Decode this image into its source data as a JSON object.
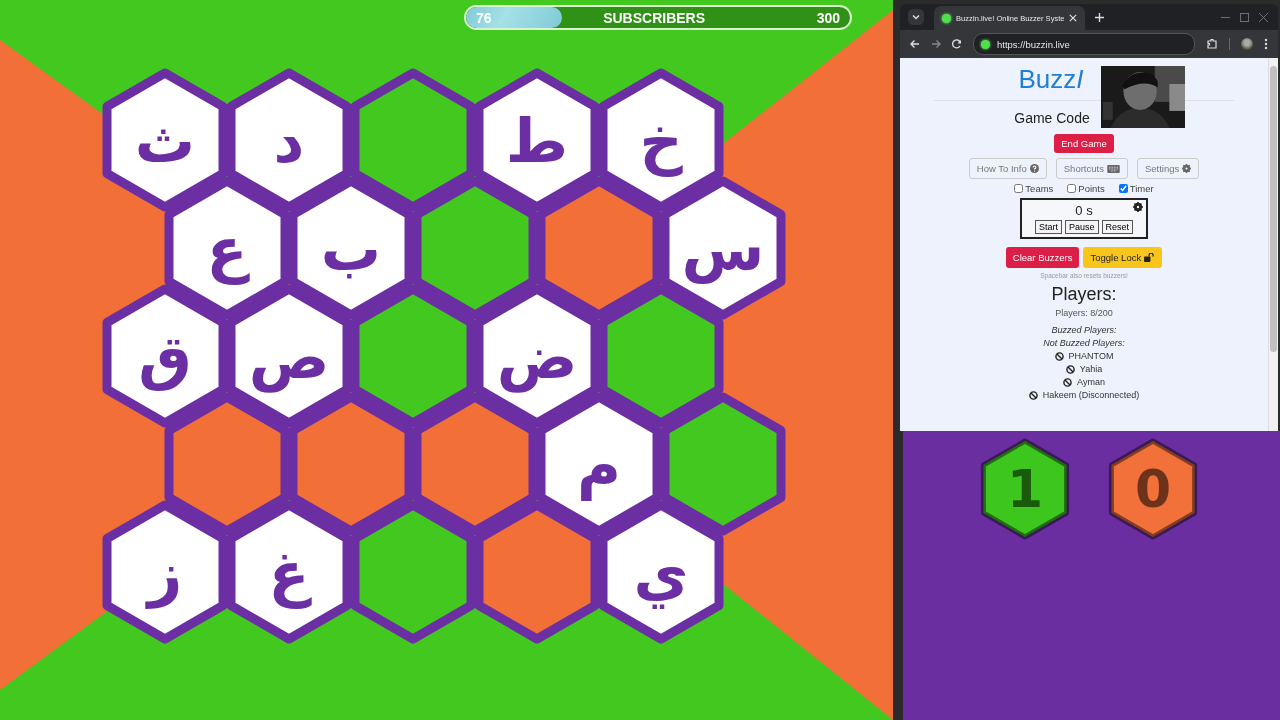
{
  "subscribers": {
    "current": "76",
    "label": "SUBSCRIBERS",
    "goal": "300",
    "level": 0.25
  },
  "board": {
    "rows": [
      [
        {
          "kind": "letter",
          "letter": "ث"
        },
        {
          "kind": "letter",
          "letter": "د"
        },
        {
          "kind": "tile",
          "color": "#43c81f"
        },
        {
          "kind": "letter",
          "letter": "ط"
        },
        {
          "kind": "letter",
          "letter": "خ"
        }
      ],
      [
        {
          "kind": "letter",
          "letter": "ع"
        },
        {
          "kind": "letter",
          "letter": "ب"
        },
        {
          "kind": "tile",
          "color": "#43c81f"
        },
        {
          "kind": "tile",
          "color": "#f26f38"
        },
        {
          "kind": "letter",
          "letter": "س"
        }
      ],
      [
        {
          "kind": "letter",
          "letter": "ق"
        },
        {
          "kind": "letter",
          "letter": "ص"
        },
        {
          "kind": "tile",
          "color": "#43c81f"
        },
        {
          "kind": "letter",
          "letter": "ض"
        },
        {
          "kind": "tile",
          "color": "#43c81f"
        }
      ],
      [
        {
          "kind": "tile",
          "color": "#f26f38"
        },
        {
          "kind": "tile",
          "color": "#f26f38"
        },
        {
          "kind": "tile",
          "color": "#f26f38"
        },
        {
          "kind": "letter",
          "letter": "م"
        },
        {
          "kind": "tile",
          "color": "#43c81f"
        }
      ],
      [
        {
          "kind": "letter",
          "letter": "ز"
        },
        {
          "kind": "letter",
          "letter": "غ"
        },
        {
          "kind": "tile",
          "color": "#43c81f"
        },
        {
          "kind": "tile",
          "color": "#f26f38"
        },
        {
          "kind": "letter",
          "letter": "ي"
        }
      ]
    ]
  },
  "browser": {
    "tab": {
      "title": "BuzzIn.live! Online Buzzer Syste"
    },
    "url": "https://buzzin.live",
    "page": {
      "title": {
        "regular": "Buzz",
        "italic": "I"
      },
      "game_code_label": "Game Code",
      "end_game": "End Game",
      "tool_buttons": [
        {
          "label": "How To Info"
        },
        {
          "label": "Shortcuts"
        },
        {
          "label": "Settings"
        }
      ],
      "options": [
        {
          "label": "Teams",
          "checked": false
        },
        {
          "label": "Points",
          "checked": false
        },
        {
          "label": "Timer",
          "checked": true
        }
      ],
      "timer": {
        "value": "0 s",
        "buttons": [
          "Start",
          "Pause",
          "Reset"
        ]
      },
      "clear_buzzers": "Clear Buzzers",
      "toggle_lock": "Toggle Lock",
      "hint": "Spacebar also resets buzzers!",
      "players_heading": "Players:",
      "players_count": "Players: 8/200",
      "buzzed_heading": "Buzzed Players:",
      "not_buzzed_heading": "Not Buzzed Players:",
      "players": [
        "PHANTOM",
        "Yahia",
        "Ayman",
        "Hakeem (Disconnected)"
      ]
    }
  },
  "team_scores": [
    {
      "score": "1",
      "color": "#3cc61e"
    },
    {
      "score": "0",
      "color": "#f2703a"
    }
  ]
}
